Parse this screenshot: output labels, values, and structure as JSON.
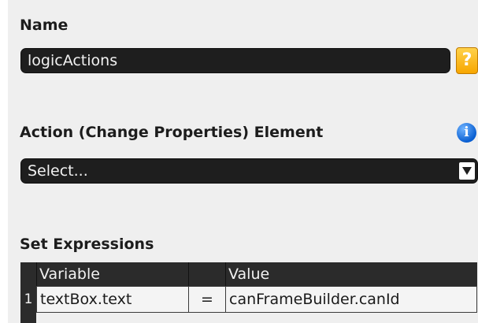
{
  "name_section": {
    "label": "Name",
    "value": "logicActions",
    "help_icon_glyph": "?",
    "help_icon": "help-icon",
    "help_color": "#f7a600"
  },
  "action_section": {
    "label": "Action (Change Properties) Element",
    "info_icon_glyph": "i",
    "info_icon": "info-icon",
    "info_color": "#0a5fd1",
    "select_value": "Select..."
  },
  "expressions_section": {
    "label": "Set Expressions",
    "columns": [
      "Variable",
      "",
      "Value"
    ],
    "rows": [
      {
        "index": "1",
        "variable": "textBox.text",
        "operator": "=",
        "value": "canFrameBuilder.canId"
      }
    ]
  },
  "colors": {
    "panel_background": "#efefef",
    "field_background": "#1e1e1e",
    "field_text": "#f2f2f2"
  }
}
